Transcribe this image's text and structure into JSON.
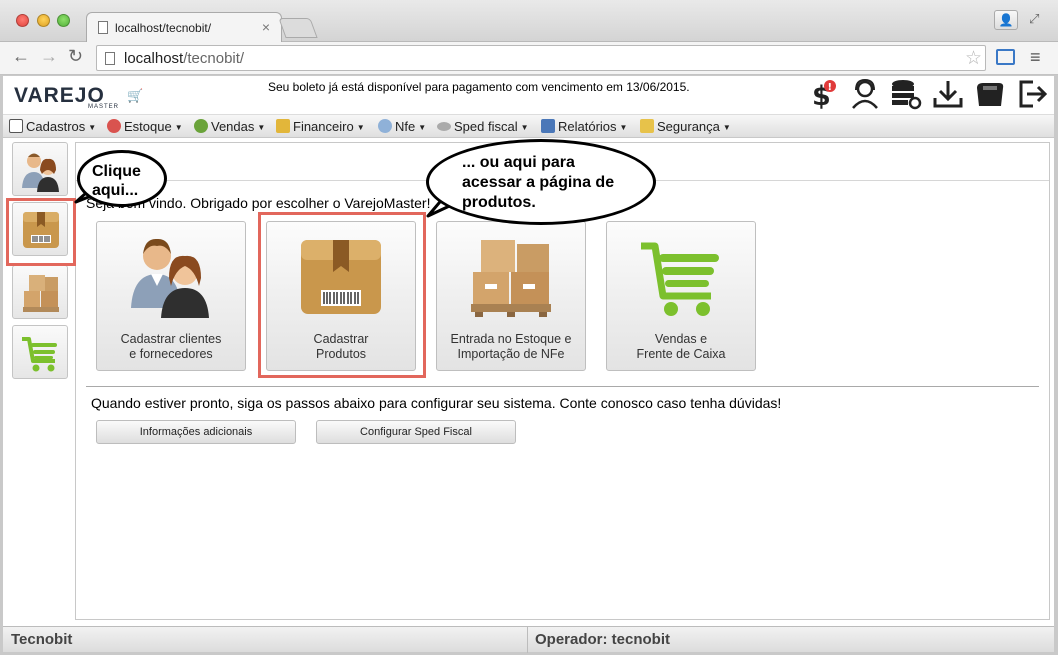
{
  "browser": {
    "tab_title": "localhost/tecnobit/",
    "tab_close": "×",
    "url_host": "localhost",
    "url_path": "/tecnobit/"
  },
  "header": {
    "logo_text": "VAREJO",
    "logo_sub": "MASTER",
    "notice": "Seu boleto já está disponível para pagamento com vencimento em 13/06/2015.",
    "icons": [
      "dollar-alert-icon",
      "support-user-icon",
      "database-settings-icon",
      "download-icon",
      "printer-icon",
      "logout-icon"
    ]
  },
  "menu": [
    {
      "label": "Cadastros",
      "icon": "cadastros-icon"
    },
    {
      "label": "Estoque",
      "icon": "estoque-icon"
    },
    {
      "label": "Vendas",
      "icon": "vendas-icon"
    },
    {
      "label": "Financeiro",
      "icon": "financeiro-icon"
    },
    {
      "label": "Nfe",
      "icon": "nfe-icon"
    },
    {
      "label": "Sped fiscal",
      "icon": "sped-icon"
    },
    {
      "label": "Relatórios",
      "icon": "relatorios-icon"
    },
    {
      "label": "Segurança",
      "icon": "seguranca-icon"
    }
  ],
  "main": {
    "welcome": "Seja bem vindo. Obrigado por escolher o VarejoMaster!",
    "cards": [
      {
        "line1": "Cadastrar clientes",
        "line2": "e fornecedores"
      },
      {
        "line1": "Cadastrar",
        "line2": "Produtos"
      },
      {
        "line1": "Entrada no Estoque e",
        "line2": "Importação de NFe"
      },
      {
        "line1": "Vendas e",
        "line2": "Frente de Caixa"
      }
    ],
    "instructions": "Quando estiver pronto, siga os passos abaixo para configurar seu sistema. Conte conosco caso tenha dúvidas!",
    "buttons": [
      "Informações adicionais",
      "Configurar Sped Fiscal"
    ]
  },
  "status": {
    "company": "Tecnobit",
    "operator": "Operador: tecnobit"
  },
  "annotations": {
    "bubble1_line1": "Clique",
    "bubble1_line2": "aqui...",
    "bubble2_line1": "... ou aqui para",
    "bubble2_line2": "acessar a página de",
    "bubble2_line3": "produtos."
  },
  "colors": {
    "highlight": "#e2675c",
    "brand_green": "#7cc02d",
    "brand_dark": "#26303f",
    "box_brown": "#c9974c"
  }
}
